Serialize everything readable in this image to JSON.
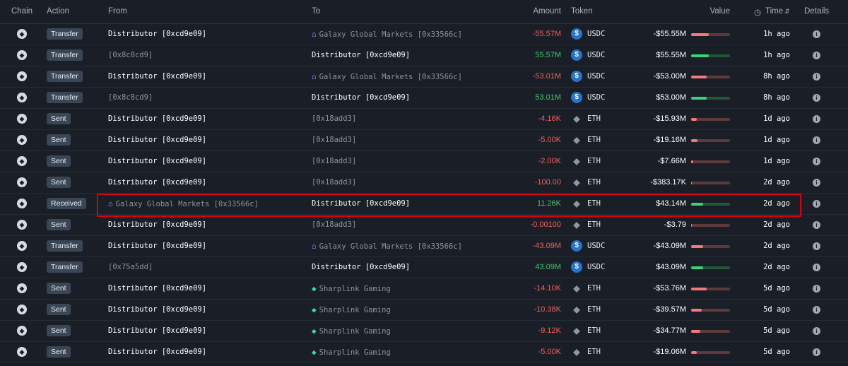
{
  "headers": {
    "chain": "Chain",
    "action": "Action",
    "from": "From",
    "to": "To",
    "amount": "Amount",
    "token": "Token",
    "value": "Value",
    "time": "Time",
    "details": "Details"
  },
  "colors": {
    "negative": "#f0605a",
    "positive": "#45c46b",
    "highlight": "#d6000f",
    "usdc": "#2775ca"
  },
  "icons": {
    "chain": "ethereum-chain-icon",
    "usdc": "usdc-token-icon",
    "eth": "eth-token-icon",
    "bank": "bank-entity-icon",
    "tag": "tag-entity-icon",
    "clock": "clock-icon",
    "sort": "sort-icon",
    "info": "info-icon"
  },
  "rows": [
    {
      "action": "Transfer",
      "from": "Distributor [0xcd9e09]",
      "from_icon": "",
      "to": "Galaxy Global Markets [0x33566c]",
      "to_icon": "bank",
      "amount": "-55.57M",
      "amount_sign": "neg",
      "token": "USDC",
      "value": "-$55.55M",
      "value_sign": "neg",
      "level": 0.45,
      "time": "1h ago"
    },
    {
      "action": "Transfer",
      "from": "[0x8c8cd9]",
      "from_icon": "",
      "to": "Distributor [0xcd9e09]",
      "to_icon": "",
      "amount": "55.57M",
      "amount_sign": "pos",
      "token": "USDC",
      "value": "$55.55M",
      "value_sign": "pos",
      "level": 0.45,
      "time": "1h ago"
    },
    {
      "action": "Transfer",
      "from": "Distributor [0xcd9e09]",
      "from_icon": "",
      "to": "Galaxy Global Markets [0x33566c]",
      "to_icon": "bank",
      "amount": "-53.01M",
      "amount_sign": "neg",
      "token": "USDC",
      "value": "-$53.00M",
      "value_sign": "neg",
      "level": 0.4,
      "time": "8h ago"
    },
    {
      "action": "Transfer",
      "from": "[0x8c8cd9]",
      "from_icon": "",
      "to": "Distributor [0xcd9e09]",
      "to_icon": "",
      "amount": "53.01M",
      "amount_sign": "pos",
      "token": "USDC",
      "value": "$53.00M",
      "value_sign": "pos",
      "level": 0.4,
      "time": "8h ago"
    },
    {
      "action": "Sent",
      "from": "Distributor [0xcd9e09]",
      "from_icon": "",
      "to": "[0x18add3]",
      "to_icon": "",
      "amount": "-4.16K",
      "amount_sign": "neg",
      "token": "ETH",
      "value": "-$15.93M",
      "value_sign": "neg",
      "level": 0.15,
      "time": "1d ago"
    },
    {
      "action": "Sent",
      "from": "Distributor [0xcd9e09]",
      "from_icon": "",
      "to": "[0x18add3]",
      "to_icon": "",
      "amount": "-5.00K",
      "amount_sign": "neg",
      "token": "ETH",
      "value": "-$19.16M",
      "value_sign": "neg",
      "level": 0.16,
      "time": "1d ago"
    },
    {
      "action": "Sent",
      "from": "Distributor [0xcd9e09]",
      "from_icon": "",
      "to": "[0x18add3]",
      "to_icon": "",
      "amount": "-2.00K",
      "amount_sign": "neg",
      "token": "ETH",
      "value": "-$7.66M",
      "value_sign": "neg",
      "level": 0.06,
      "time": "1d ago"
    },
    {
      "action": "Sent",
      "from": "Distributor [0xcd9e09]",
      "from_icon": "",
      "to": "[0x18add3]",
      "to_icon": "",
      "amount": "-100.00",
      "amount_sign": "neg",
      "token": "ETH",
      "value": "-$383.17K",
      "value_sign": "neg",
      "level": 0.01,
      "time": "2d ago"
    },
    {
      "action": "Received",
      "from": "Galaxy Global Markets [0x33566c]",
      "from_icon": "bank",
      "to": "Distributor [0xcd9e09]",
      "to_icon": "",
      "amount": "11.26K",
      "amount_sign": "pos",
      "token": "ETH",
      "value": "$43.14M",
      "value_sign": "pos",
      "level": 0.3,
      "time": "2d ago",
      "highlighted": true
    },
    {
      "action": "Sent",
      "from": "Distributor [0xcd9e09]",
      "from_icon": "",
      "to": "[0x18add3]",
      "to_icon": "",
      "amount": "-0.00100",
      "amount_sign": "neg",
      "token": "ETH",
      "value": "-$3.79",
      "value_sign": "neg",
      "level": 0.0,
      "time": "2d ago"
    },
    {
      "action": "Transfer",
      "from": "Distributor [0xcd9e09]",
      "from_icon": "",
      "to": "Galaxy Global Markets [0x33566c]",
      "to_icon": "bank",
      "amount": "-43.09M",
      "amount_sign": "neg",
      "token": "USDC",
      "value": "-$43.09M",
      "value_sign": "neg",
      "level": 0.3,
      "time": "2d ago"
    },
    {
      "action": "Transfer",
      "from": "[0x75a5dd]",
      "from_icon": "",
      "to": "Distributor [0xcd9e09]",
      "to_icon": "",
      "amount": "43.09M",
      "amount_sign": "pos",
      "token": "USDC",
      "value": "$43.09M",
      "value_sign": "pos",
      "level": 0.3,
      "time": "2d ago"
    },
    {
      "action": "Sent",
      "from": "Distributor [0xcd9e09]",
      "from_icon": "",
      "to": "Sharplink Gaming",
      "to_icon": "tag",
      "amount": "-14.10K",
      "amount_sign": "neg",
      "token": "ETH",
      "value": "-$53.76M",
      "value_sign": "neg",
      "level": 0.4,
      "time": "5d ago"
    },
    {
      "action": "Sent",
      "from": "Distributor [0xcd9e09]",
      "from_icon": "",
      "to": "Sharplink Gaming",
      "to_icon": "tag",
      "amount": "-10.38K",
      "amount_sign": "neg",
      "token": "ETH",
      "value": "-$39.57M",
      "value_sign": "neg",
      "level": 0.28,
      "time": "5d ago"
    },
    {
      "action": "Sent",
      "from": "Distributor [0xcd9e09]",
      "from_icon": "",
      "to": "Sharplink Gaming",
      "to_icon": "tag",
      "amount": "-9.12K",
      "amount_sign": "neg",
      "token": "ETH",
      "value": "-$34.77M",
      "value_sign": "neg",
      "level": 0.24,
      "time": "5d ago"
    },
    {
      "action": "Sent",
      "from": "Distributor [0xcd9e09]",
      "from_icon": "",
      "to": "Sharplink Gaming",
      "to_icon": "tag",
      "amount": "-5.00K",
      "amount_sign": "neg",
      "token": "ETH",
      "value": "-$19.06M",
      "value_sign": "neg",
      "level": 0.15,
      "time": "5d ago"
    }
  ]
}
